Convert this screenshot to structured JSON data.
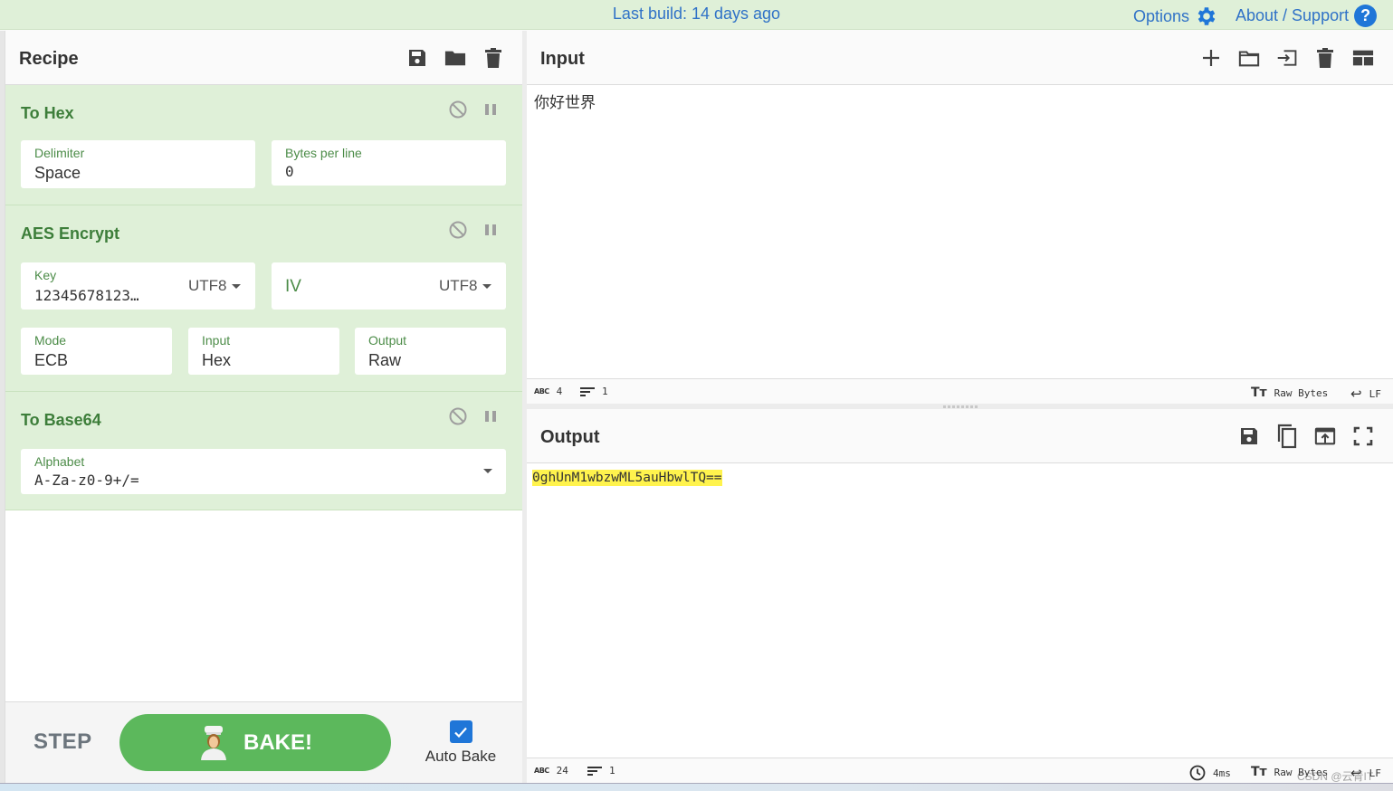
{
  "banner": {
    "last_build": "Last build: 14 days ago",
    "options_label": "Options",
    "about_label": "About / Support",
    "accent_color": "#3072c7"
  },
  "recipe": {
    "title": "Recipe",
    "header_icons": [
      "save-icon",
      "folder-icon",
      "trash-icon"
    ],
    "operations": [
      {
        "name": "To Hex",
        "fields": [
          {
            "label": "Delimiter",
            "value": "Space"
          },
          {
            "label": "Bytes per line",
            "value": "0"
          }
        ]
      },
      {
        "name": "AES Encrypt",
        "fields": [
          {
            "label": "Key",
            "value": "12345678123…",
            "encoding": "UTF8"
          },
          {
            "label": "IV",
            "value": "",
            "encoding": "UTF8"
          },
          {
            "label": "Mode",
            "value": "ECB"
          },
          {
            "label": "Input",
            "value": "Hex"
          },
          {
            "label": "Output",
            "value": "Raw"
          }
        ]
      },
      {
        "name": "To Base64",
        "fields": [
          {
            "label": "Alphabet",
            "value": "A-Za-z0-9+/="
          }
        ]
      }
    ],
    "step_label": "STEP",
    "bake_label": "BAKE!",
    "auto_bake_label": "Auto Bake",
    "auto_bake_checked": true,
    "op_bg_color": "#dff0d8",
    "bake_color": "#5cb85c"
  },
  "input": {
    "title": "Input",
    "header_icons": [
      "plus-icon",
      "folder-icon",
      "sign-in-icon",
      "trash-icon",
      "layout-icon"
    ],
    "text": "你好世界",
    "status": {
      "length": "4",
      "lines": "1",
      "encoding": "Raw Bytes",
      "eol": "LF"
    }
  },
  "output": {
    "title": "Output",
    "header_icons": [
      "save-icon",
      "copy-icon",
      "move-to-input-icon",
      "maximize-icon"
    ],
    "text": "0ghUnM1wbzwML5auHbwlTQ==",
    "highlight_color": "#fff34d",
    "status": {
      "length": "24",
      "lines": "1",
      "time": "4ms",
      "encoding": "Raw Bytes",
      "eol": "LF"
    }
  },
  "watermark": "CSDN @云青IT"
}
